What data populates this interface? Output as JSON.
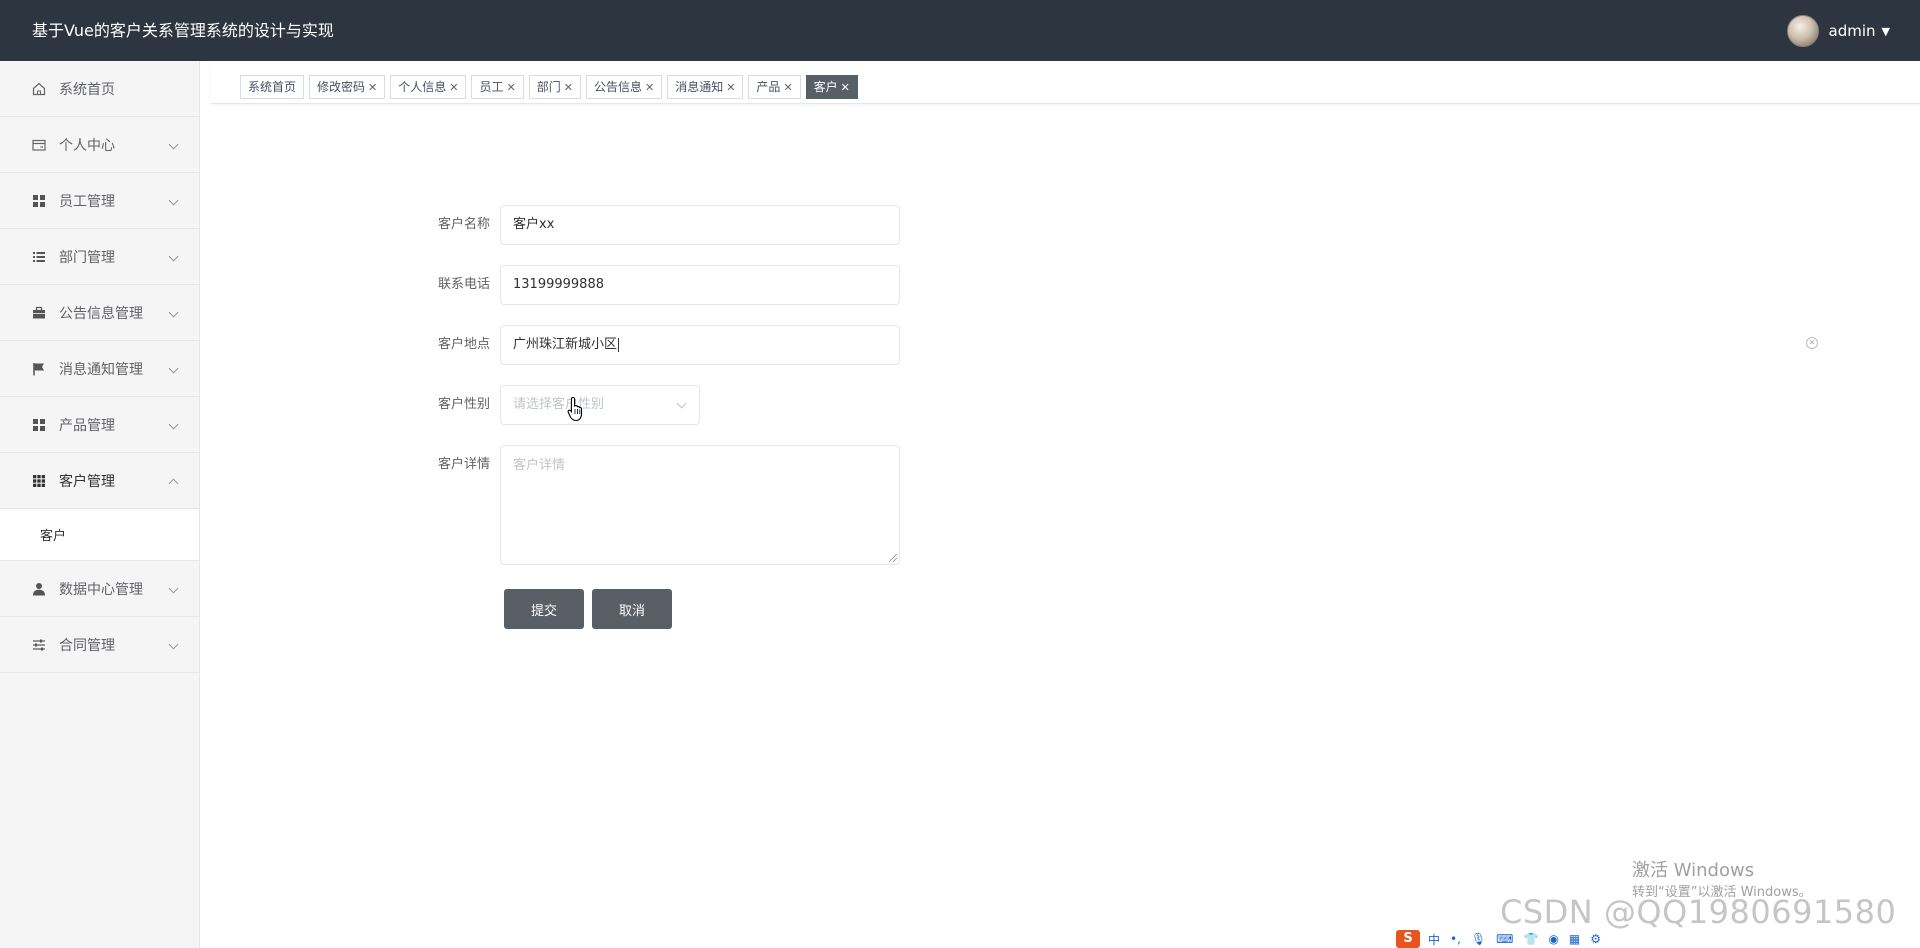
{
  "app": {
    "title": "基于Vue的客户关系管理系统的设计与实现",
    "user_name": "admin"
  },
  "sidebar": {
    "items": [
      {
        "label": "系统首页",
        "icon": "home-icon",
        "expandable": false
      },
      {
        "label": "个人中心",
        "icon": "wallet-icon",
        "expandable": true
      },
      {
        "label": "员工管理",
        "icon": "grid-icon",
        "expandable": true
      },
      {
        "label": "部门管理",
        "icon": "list-icon",
        "expandable": true
      },
      {
        "label": "公告信息管理",
        "icon": "briefcase-icon",
        "expandable": true
      },
      {
        "label": "消息通知管理",
        "icon": "flag-icon",
        "expandable": true
      },
      {
        "label": "产品管理",
        "icon": "grid-icon",
        "expandable": true
      },
      {
        "label": "客户管理",
        "icon": "apps-icon",
        "expandable": true,
        "expanded": true
      },
      {
        "label": "数据中心管理",
        "icon": "user-icon",
        "expandable": true
      },
      {
        "label": "合同管理",
        "icon": "sliders-icon",
        "expandable": true
      }
    ],
    "submenu": {
      "label": "客户"
    }
  },
  "tabs": [
    {
      "label": "系统首页",
      "closable": false,
      "active": false
    },
    {
      "label": "修改密码",
      "closable": true,
      "active": false
    },
    {
      "label": "个人信息",
      "closable": true,
      "active": false
    },
    {
      "label": "员工",
      "closable": true,
      "active": false
    },
    {
      "label": "部门",
      "closable": true,
      "active": false
    },
    {
      "label": "公告信息",
      "closable": true,
      "active": false
    },
    {
      "label": "消息通知",
      "closable": true,
      "active": false
    },
    {
      "label": "产品",
      "closable": true,
      "active": false
    },
    {
      "label": "客户",
      "closable": true,
      "active": true
    }
  ],
  "form": {
    "name": {
      "label": "客户名称",
      "value": "客户xx"
    },
    "phone": {
      "label": "联系电话",
      "value": "13199999888"
    },
    "address": {
      "label": "客户地点",
      "value": "广州珠江新城小区"
    },
    "gender": {
      "label": "客户性别",
      "placeholder": "请选择客户性别"
    },
    "detail": {
      "label": "客户详情",
      "placeholder": "客户详情"
    },
    "submit_label": "提交",
    "cancel_label": "取消"
  },
  "overlay": {
    "windows_line1": "激活 Windows",
    "windows_line2": "转到“设置”以激活 Windows。",
    "watermark": "CSDN @QQ1980691580",
    "ime_logo": "S",
    "ime_lang": "中"
  },
  "colors": {
    "header_bg": "#2d3640",
    "sidebar_bg": "#f5f5f5",
    "accent": "#585f66"
  }
}
